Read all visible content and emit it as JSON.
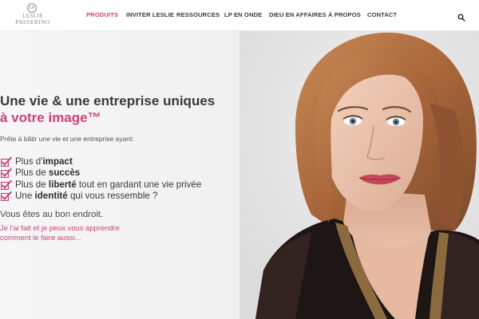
{
  "brand": {
    "logo_line1": "LESLIE",
    "logo_line2": "PASSERINO",
    "logo_monogram": "LP",
    "accent_color": "#c8457a"
  },
  "nav": {
    "items": [
      {
        "label": "PRODUITS",
        "active": true
      },
      {
        "label": "INVITER LESLIE",
        "active": false
      },
      {
        "label": "RESSOURCES",
        "active": false
      },
      {
        "label": "LP EN ONDE",
        "active": false
      },
      {
        "label": "DIEU EN AFFAIRES",
        "active": false
      },
      {
        "label": "À PROPOS",
        "active": false
      },
      {
        "label": "CONTACT",
        "active": false
      }
    ],
    "search_icon": "search-icon"
  },
  "hero": {
    "headline": "Une vie & une  entreprise uniques",
    "subhead": "à votre image™",
    "intro": "Prête à bâtir une vie et une entreprise ayant:",
    "checklist": [
      {
        "prefix": "Plus d'",
        "bold": "impact",
        "suffix": ""
      },
      {
        "prefix": "Plus de ",
        "bold": "succès",
        "suffix": ""
      },
      {
        "prefix": "Plus de ",
        "bold": "liberté",
        "suffix": " tout en gardant une vie privée"
      },
      {
        "prefix": "Une ",
        "bold": "identité",
        "suffix": " qui vous ressemble ?"
      }
    ],
    "check_icon": "checkbox-check-icon",
    "closing": "Vous êtes au bon endroit.",
    "promise_line1": "Je l'ai fait et je peux vous apprendre",
    "promise_line2": "comment le faire aussi..."
  }
}
